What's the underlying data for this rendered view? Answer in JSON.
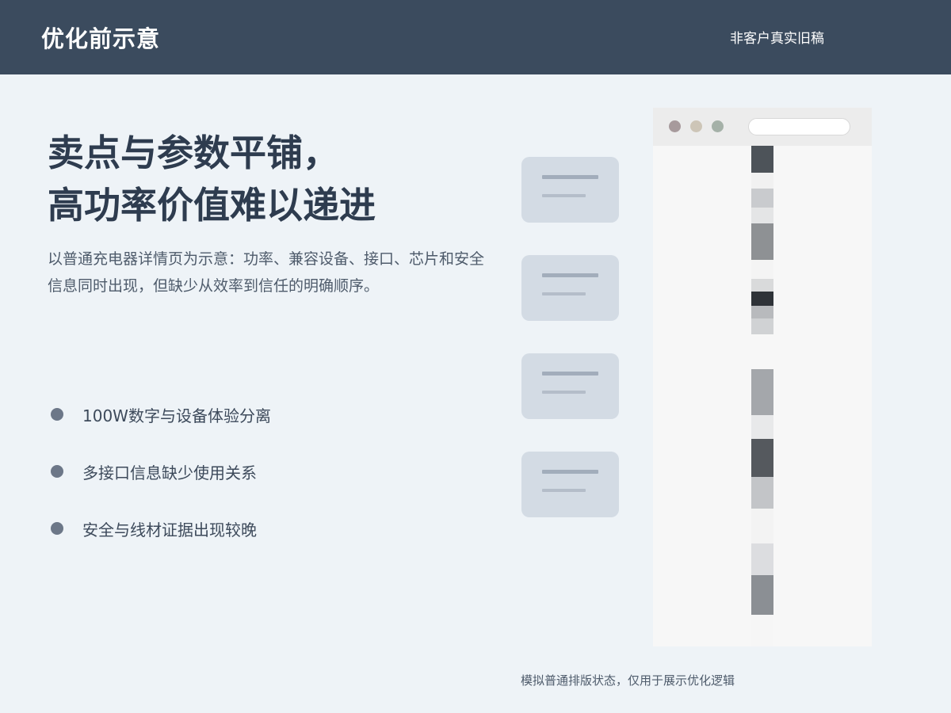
{
  "header": {
    "title": "优化前示意",
    "note": "非客户真实旧稿"
  },
  "headline": {
    "line1": "卖点与参数平铺，",
    "line2": "高功率价值难以递进"
  },
  "description": "以普通充电器详情页为示意：功率、兼容设备、接口、芯片和安全信息同时出现，但缺少从效率到信任的明确顺序。",
  "bullets": [
    "100W数字与设备体验分离",
    "多接口信息缺少使用关系",
    "安全与线材证据出现较晚"
  ],
  "footnote": "模拟普通排版状态，仅用于展示优化逻辑",
  "colors": {
    "header_bg": "#3b4b5e",
    "page_bg": "#eef3f7",
    "card_bg": "#d3dbe4",
    "bullet_dot": "#6c7788"
  }
}
